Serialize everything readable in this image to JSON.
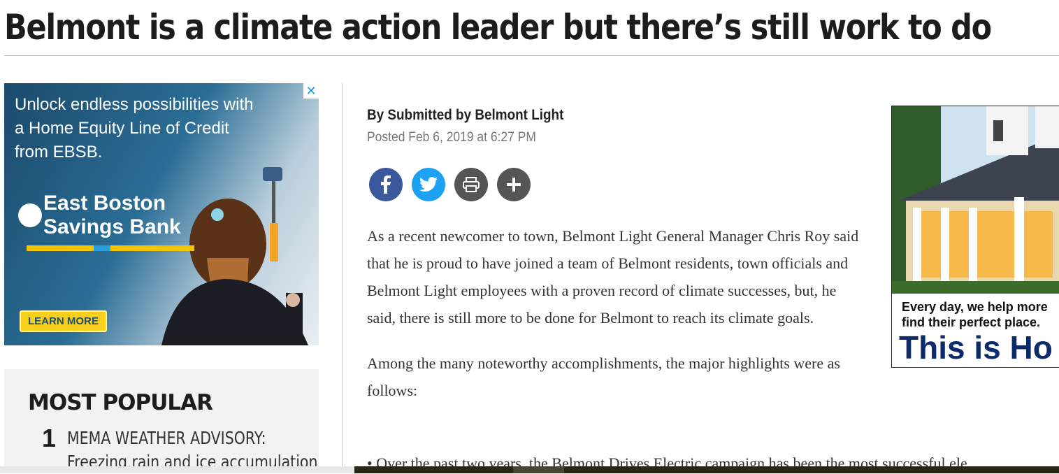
{
  "headline": "Belmont is a climate action leader but there’s still work to do",
  "ad_left": {
    "text": "Unlock endless possibilities with a Home Equity Line of Credit from EBSB.",
    "close": "✕",
    "logo_line1": "East Boston",
    "logo_line2": "Savings Bank",
    "cta": "LEARN MORE"
  },
  "most_popular": {
    "title": "MOST POPULAR",
    "items": [
      {
        "rank": "1",
        "line1": "MEMA WEATHER ADVISORY:",
        "line2": "Freezing rain and ice accumulation"
      }
    ]
  },
  "byline": "By Submitted by Belmont Light",
  "posted": "Posted Feb 6, 2019 at 6:27 PM",
  "share": {
    "facebook": "facebook-icon",
    "twitter": "twitter-icon",
    "print": "print-icon",
    "more": "plus-icon"
  },
  "article": {
    "p1": "As a recent newcomer to town, Belmont Light General Manager Chris Roy said that he is proud to have joined a team of Belmont residents, town officials and Belmont Light employees with a proven record of climate successes, but, he said, there is still more to be done for Belmont to reach its climate goals.",
    "p2": "Among the many noteworthy accomplishments, the major highlights were as follows:",
    "bullet": "• Over the past two years, the Belmont Drives Electric campaign has been the most successful ele"
  },
  "ad_right": {
    "tagline1": "Every day, we help more",
    "tagline2": "find their perfect place.",
    "brand": "This is Ho"
  },
  "colors": {
    "facebook": "#3a589b",
    "twitter": "#1da1f2",
    "print": "#555555",
    "brand_navy": "#0d2b6b"
  }
}
